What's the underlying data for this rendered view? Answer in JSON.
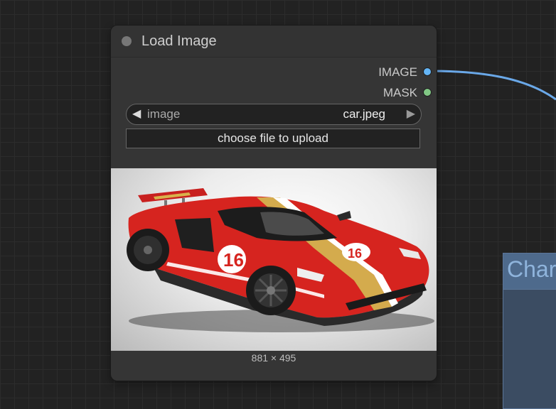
{
  "node": {
    "title": "Load Image",
    "outputs": [
      {
        "label": "IMAGE",
        "color": "#64b5f6"
      },
      {
        "label": "MASK",
        "color": "#81c784"
      }
    ],
    "image_widget": {
      "name": "image",
      "value": "car.jpeg",
      "prev_icon": "triangle-left-icon",
      "next_icon": "triangle-right-icon"
    },
    "upload_button": {
      "label": "choose file to upload"
    },
    "preview": {
      "subject": "red race car with white and gold stripes, number 16",
      "dimensions": "881 × 495"
    }
  },
  "second_node": {
    "title": "Char"
  },
  "link_color": "#64b5f6"
}
